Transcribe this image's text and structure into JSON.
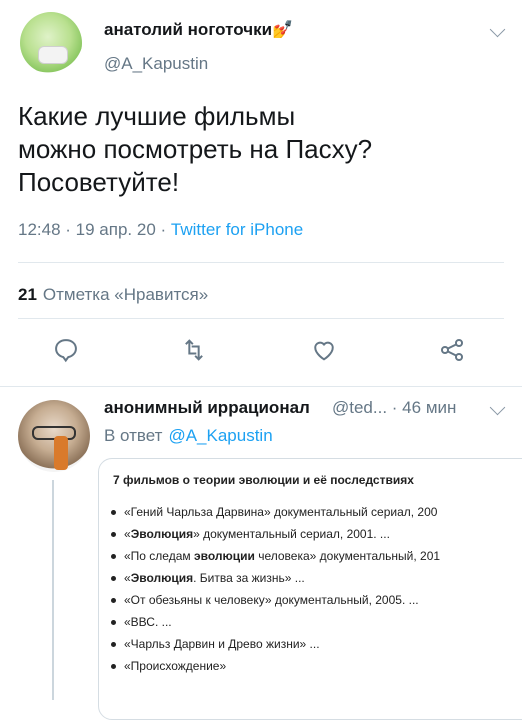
{
  "main_tweet": {
    "display_name": "анатолий ноготочки💅",
    "handle": "@A_Kapustin",
    "text": "Какие лучшие фильмы\nможно посмотреть на Пасху?\nПосоветуйте!",
    "time": "12:48",
    "date": "19 апр. 20",
    "source": "Twitter for iPhone",
    "likes_count": "21",
    "likes_label": "Отметка «Нравится»",
    "actions": [
      "reply-icon",
      "retweet-icon",
      "like-icon",
      "share-icon"
    ]
  },
  "reply": {
    "display_name": "анонимный иррационал",
    "handle": "@ted...",
    "time": "· 46 мин",
    "reply_to_prefix": "В ответ",
    "reply_to_mention": "@A_Kapustin",
    "card": {
      "title": "7 фильмов о теории эволюции и её последствиях",
      "items": [
        {
          "pre": "«Гений Чарльза Дарвина» документальный сериал, 200",
          "bold": "",
          "post": ""
        },
        {
          "pre": "«",
          "bold": "Эволюция",
          "post": "» документальный сериал, 2001. ..."
        },
        {
          "pre": "«По следам ",
          "bold": "эволюции",
          "post": " человека» документальный, 201"
        },
        {
          "pre": "«",
          "bold": "Эволюция",
          "post": ". Битва за жизнь» ..."
        },
        {
          "pre": "«От обезьяны к человеку» документальный, 2005. ...",
          "bold": "",
          "post": ""
        },
        {
          "pre": "«ВВС. ...",
          "bold": "",
          "post": ""
        },
        {
          "pre": "«Чарльз Дарвин и Древо жизни» ...",
          "bold": "",
          "post": ""
        },
        {
          "pre": "«Происхождение»",
          "bold": "",
          "post": ""
        }
      ]
    }
  },
  "colors": {
    "link": "#1da1f2",
    "secondary_text": "#657786",
    "divider": "#e1e8ed"
  }
}
